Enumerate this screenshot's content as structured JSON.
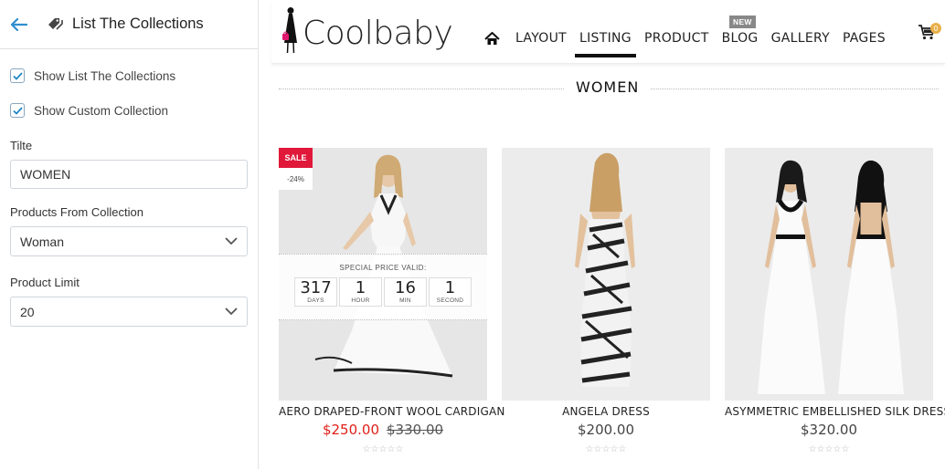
{
  "panel": {
    "title": "List The Collections",
    "checkboxes": [
      {
        "label": "Show List The Collections",
        "checked": true
      },
      {
        "label": "Show Custom Collection",
        "checked": true
      }
    ],
    "title_field": {
      "label": "Tilte",
      "value": "WOMEN"
    },
    "collection_field": {
      "label": "Products From Collection",
      "value": "Woman"
    },
    "limit_field": {
      "label": "Product Limit",
      "value": "20"
    }
  },
  "store": {
    "logo": "Coolbaby",
    "nav": [
      "LAYOUT",
      "LISTING",
      "PRODUCT",
      "BLOG",
      "GALLERY",
      "PAGES"
    ],
    "active_nav": "LISTING",
    "new_badge": "NEW",
    "cart_count": "0",
    "section_title": "WOMEN",
    "products": [
      {
        "name": "AERO DRAPED-FRONT WOOL CARDIGAN",
        "price": "$250.00",
        "old_price": "$330.00",
        "sale_label": "SALE",
        "discount": "-24%",
        "countdown": {
          "title": "SPECIAL PRICE VALID:",
          "units": [
            {
              "value": "317",
              "unit": "DAYS"
            },
            {
              "value": "1",
              "unit": "HOUR"
            },
            {
              "value": "16",
              "unit": "MIN"
            },
            {
              "value": "1",
              "unit": "SECOND"
            }
          ]
        },
        "rating": "☆☆☆☆☆"
      },
      {
        "name": "ANGELA DRESS",
        "price": "$200.00",
        "rating": "☆☆☆☆☆"
      },
      {
        "name": "ASYMMETRIC EMBELLISHED SILK DRESS",
        "price": "$320.00",
        "rating": "☆☆☆☆☆"
      }
    ]
  },
  "colors": {
    "accent": "#1e88c7",
    "sale": "#e0183a",
    "price_sale": "#e0201a"
  }
}
